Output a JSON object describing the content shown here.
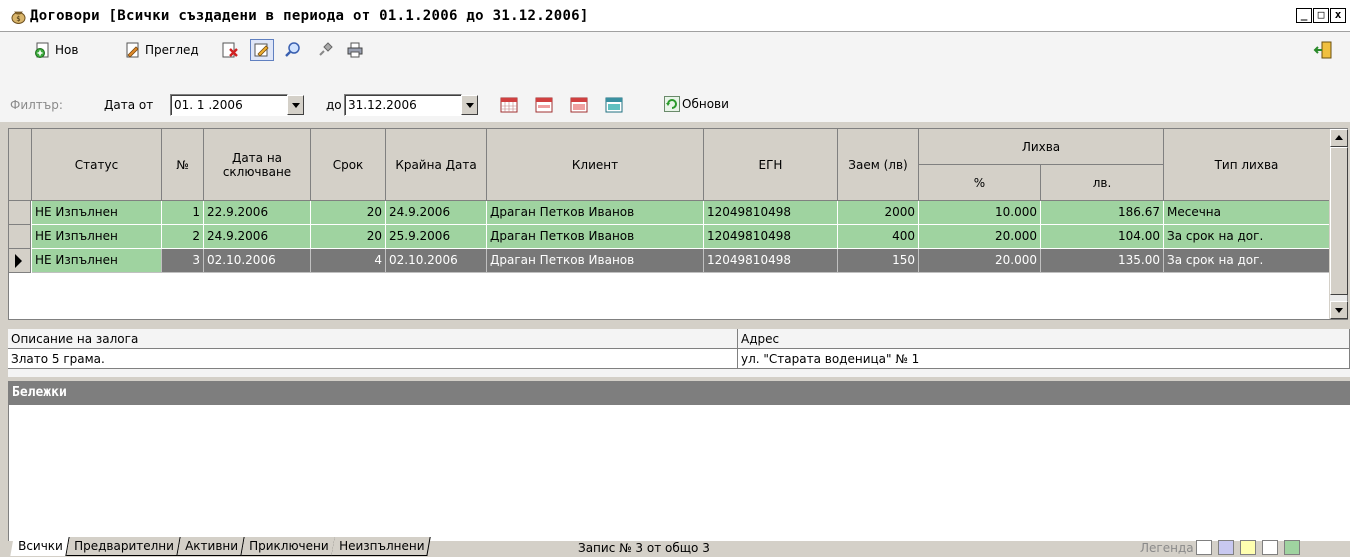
{
  "window": {
    "title": "Договори [Всички създадени в периода от 01.1.2006 до 31.12.2006]",
    "min_label": "_",
    "max_label": "□",
    "close_label": "x"
  },
  "toolbar": {
    "new_label": "Нов",
    "view_label": "Преглед"
  },
  "filter": {
    "label": "Филтър:",
    "from_label": "Дата от",
    "from_value": "01. 1 .2006",
    "to_label": "до",
    "to_value": "31.12.2006",
    "refresh_label": "Обнови"
  },
  "grid": {
    "headers": {
      "status": "Статус",
      "num": "№",
      "date": "Дата на сключване",
      "term": "Срок",
      "end_date": "Крайна Дата",
      "client": "Клиент",
      "egn": "ЕГН",
      "loan": "Заем (лв)",
      "interest": "Лихва",
      "interest_pct": "%",
      "interest_lv": "лв.",
      "interest_type": "Тип лихва"
    },
    "rows": [
      {
        "status": "НЕ Изпълнен",
        "num": "1",
        "date": "22.9.2006",
        "term": "20",
        "end": "24.9.2006",
        "client": "Драган Петков Иванов",
        "egn": "12049810498",
        "loan": "2000",
        "pct": "10.000",
        "lv": "186.67",
        "type": "Месечна"
      },
      {
        "status": "НЕ Изпълнен",
        "num": "2",
        "date": "24.9.2006",
        "term": "20",
        "end": "25.9.2006",
        "client": "Драган Петков Иванов",
        "egn": "12049810498",
        "loan": "400",
        "pct": "20.000",
        "lv": "104.00",
        "type": "За срок на дог."
      },
      {
        "status": "НЕ Изпълнен",
        "num": "3",
        "date": "02.10.2006",
        "term": "4",
        "end": "02.10.2006",
        "client": "Драган Петков Иванов",
        "egn": "12049810498",
        "loan": "150",
        "pct": "20.000",
        "lv": "135.00",
        "type": "За срок на дог."
      }
    ]
  },
  "detail": {
    "pledge_label": "Описание на залога",
    "pledge_value": "Злато 5 грама.",
    "address_label": "Адрес",
    "address_value": "ул. \"Старата воденица\" № 1"
  },
  "notes": {
    "title": "Бележки"
  },
  "tabs": [
    "Всички",
    "Предварителни",
    "Активни",
    "Приключени",
    "Неизпълнени"
  ],
  "status": {
    "record_text": "Запис № 3 от общо 3",
    "legend_label": "Легенда"
  },
  "legend_colors": [
    "#ffffff",
    "#c8c8f0",
    "#ffffb0",
    "#ffffff",
    "#9fd3a0"
  ],
  "colors": {
    "row_green": "#9fd3a0",
    "row_selected": "#787878",
    "notes_header": "#7e7e7e"
  }
}
